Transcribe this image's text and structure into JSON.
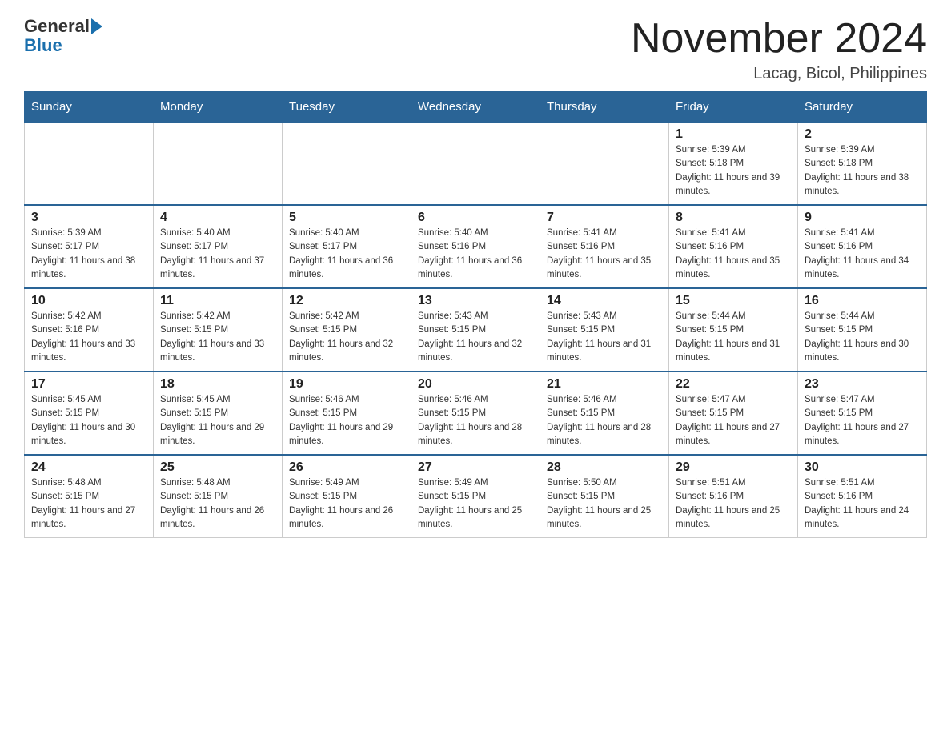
{
  "header": {
    "logo_general": "General",
    "logo_blue": "Blue",
    "title": "November 2024",
    "subtitle": "Lacag, Bicol, Philippines"
  },
  "days_of_week": [
    "Sunday",
    "Monday",
    "Tuesday",
    "Wednesday",
    "Thursday",
    "Friday",
    "Saturday"
  ],
  "weeks": [
    [
      {
        "day": "",
        "sunrise": "",
        "sunset": "",
        "daylight": ""
      },
      {
        "day": "",
        "sunrise": "",
        "sunset": "",
        "daylight": ""
      },
      {
        "day": "",
        "sunrise": "",
        "sunset": "",
        "daylight": ""
      },
      {
        "day": "",
        "sunrise": "",
        "sunset": "",
        "daylight": ""
      },
      {
        "day": "",
        "sunrise": "",
        "sunset": "",
        "daylight": ""
      },
      {
        "day": "1",
        "sunrise": "Sunrise: 5:39 AM",
        "sunset": "Sunset: 5:18 PM",
        "daylight": "Daylight: 11 hours and 39 minutes."
      },
      {
        "day": "2",
        "sunrise": "Sunrise: 5:39 AM",
        "sunset": "Sunset: 5:18 PM",
        "daylight": "Daylight: 11 hours and 38 minutes."
      }
    ],
    [
      {
        "day": "3",
        "sunrise": "Sunrise: 5:39 AM",
        "sunset": "Sunset: 5:17 PM",
        "daylight": "Daylight: 11 hours and 38 minutes."
      },
      {
        "day": "4",
        "sunrise": "Sunrise: 5:40 AM",
        "sunset": "Sunset: 5:17 PM",
        "daylight": "Daylight: 11 hours and 37 minutes."
      },
      {
        "day": "5",
        "sunrise": "Sunrise: 5:40 AM",
        "sunset": "Sunset: 5:17 PM",
        "daylight": "Daylight: 11 hours and 36 minutes."
      },
      {
        "day": "6",
        "sunrise": "Sunrise: 5:40 AM",
        "sunset": "Sunset: 5:16 PM",
        "daylight": "Daylight: 11 hours and 36 minutes."
      },
      {
        "day": "7",
        "sunrise": "Sunrise: 5:41 AM",
        "sunset": "Sunset: 5:16 PM",
        "daylight": "Daylight: 11 hours and 35 minutes."
      },
      {
        "day": "8",
        "sunrise": "Sunrise: 5:41 AM",
        "sunset": "Sunset: 5:16 PM",
        "daylight": "Daylight: 11 hours and 35 minutes."
      },
      {
        "day": "9",
        "sunrise": "Sunrise: 5:41 AM",
        "sunset": "Sunset: 5:16 PM",
        "daylight": "Daylight: 11 hours and 34 minutes."
      }
    ],
    [
      {
        "day": "10",
        "sunrise": "Sunrise: 5:42 AM",
        "sunset": "Sunset: 5:16 PM",
        "daylight": "Daylight: 11 hours and 33 minutes."
      },
      {
        "day": "11",
        "sunrise": "Sunrise: 5:42 AM",
        "sunset": "Sunset: 5:15 PM",
        "daylight": "Daylight: 11 hours and 33 minutes."
      },
      {
        "day": "12",
        "sunrise": "Sunrise: 5:42 AM",
        "sunset": "Sunset: 5:15 PM",
        "daylight": "Daylight: 11 hours and 32 minutes."
      },
      {
        "day": "13",
        "sunrise": "Sunrise: 5:43 AM",
        "sunset": "Sunset: 5:15 PM",
        "daylight": "Daylight: 11 hours and 32 minutes."
      },
      {
        "day": "14",
        "sunrise": "Sunrise: 5:43 AM",
        "sunset": "Sunset: 5:15 PM",
        "daylight": "Daylight: 11 hours and 31 minutes."
      },
      {
        "day": "15",
        "sunrise": "Sunrise: 5:44 AM",
        "sunset": "Sunset: 5:15 PM",
        "daylight": "Daylight: 11 hours and 31 minutes."
      },
      {
        "day": "16",
        "sunrise": "Sunrise: 5:44 AM",
        "sunset": "Sunset: 5:15 PM",
        "daylight": "Daylight: 11 hours and 30 minutes."
      }
    ],
    [
      {
        "day": "17",
        "sunrise": "Sunrise: 5:45 AM",
        "sunset": "Sunset: 5:15 PM",
        "daylight": "Daylight: 11 hours and 30 minutes."
      },
      {
        "day": "18",
        "sunrise": "Sunrise: 5:45 AM",
        "sunset": "Sunset: 5:15 PM",
        "daylight": "Daylight: 11 hours and 29 minutes."
      },
      {
        "day": "19",
        "sunrise": "Sunrise: 5:46 AM",
        "sunset": "Sunset: 5:15 PM",
        "daylight": "Daylight: 11 hours and 29 minutes."
      },
      {
        "day": "20",
        "sunrise": "Sunrise: 5:46 AM",
        "sunset": "Sunset: 5:15 PM",
        "daylight": "Daylight: 11 hours and 28 minutes."
      },
      {
        "day": "21",
        "sunrise": "Sunrise: 5:46 AM",
        "sunset": "Sunset: 5:15 PM",
        "daylight": "Daylight: 11 hours and 28 minutes."
      },
      {
        "day": "22",
        "sunrise": "Sunrise: 5:47 AM",
        "sunset": "Sunset: 5:15 PM",
        "daylight": "Daylight: 11 hours and 27 minutes."
      },
      {
        "day": "23",
        "sunrise": "Sunrise: 5:47 AM",
        "sunset": "Sunset: 5:15 PM",
        "daylight": "Daylight: 11 hours and 27 minutes."
      }
    ],
    [
      {
        "day": "24",
        "sunrise": "Sunrise: 5:48 AM",
        "sunset": "Sunset: 5:15 PM",
        "daylight": "Daylight: 11 hours and 27 minutes."
      },
      {
        "day": "25",
        "sunrise": "Sunrise: 5:48 AM",
        "sunset": "Sunset: 5:15 PM",
        "daylight": "Daylight: 11 hours and 26 minutes."
      },
      {
        "day": "26",
        "sunrise": "Sunrise: 5:49 AM",
        "sunset": "Sunset: 5:15 PM",
        "daylight": "Daylight: 11 hours and 26 minutes."
      },
      {
        "day": "27",
        "sunrise": "Sunrise: 5:49 AM",
        "sunset": "Sunset: 5:15 PM",
        "daylight": "Daylight: 11 hours and 25 minutes."
      },
      {
        "day": "28",
        "sunrise": "Sunrise: 5:50 AM",
        "sunset": "Sunset: 5:15 PM",
        "daylight": "Daylight: 11 hours and 25 minutes."
      },
      {
        "day": "29",
        "sunrise": "Sunrise: 5:51 AM",
        "sunset": "Sunset: 5:16 PM",
        "daylight": "Daylight: 11 hours and 25 minutes."
      },
      {
        "day": "30",
        "sunrise": "Sunrise: 5:51 AM",
        "sunset": "Sunset: 5:16 PM",
        "daylight": "Daylight: 11 hours and 24 minutes."
      }
    ]
  ]
}
